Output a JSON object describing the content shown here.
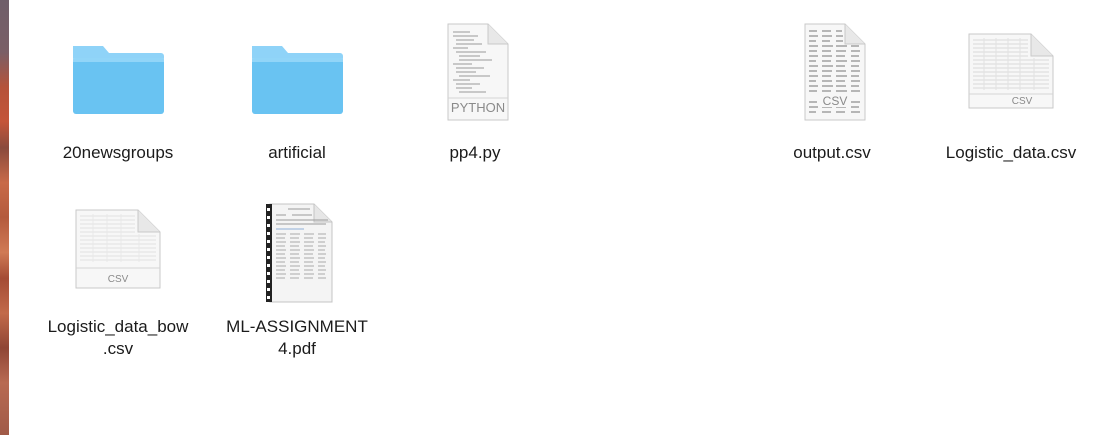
{
  "files": [
    {
      "name": "20newsgroups",
      "icon": "folder-icon"
    },
    {
      "name": "artificial",
      "icon": "folder-icon"
    },
    {
      "name": "pp4.py",
      "icon": "python-file-icon",
      "badge": "PYTHON"
    },
    {
      "name": "output.csv",
      "icon": "csv-file-icon",
      "badge": "CSV"
    },
    {
      "name": "Logistic_data.csv",
      "icon": "csv-file-icon",
      "badge": "CSV"
    },
    {
      "name": "Logistic_data_bow\n.csv",
      "icon": "csv-file-icon",
      "badge": "CSV"
    },
    {
      "name": "ML-ASSIGNMENT\n4.pdf",
      "icon": "pdf-file-icon"
    }
  ],
  "colors": {
    "folder_top": "#8fd3f8",
    "folder_body": "#69c3f2",
    "label_text": "#1b1b1b"
  }
}
